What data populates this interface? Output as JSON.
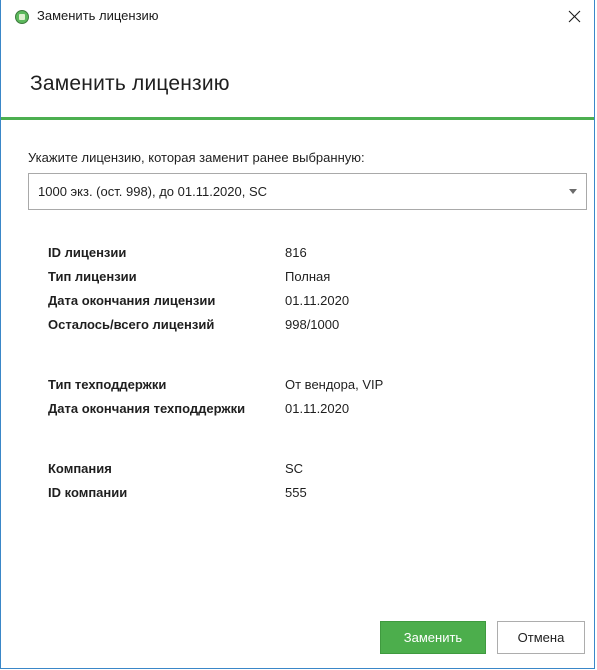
{
  "window": {
    "title": "Заменить лицензию",
    "close_glyph": "✕"
  },
  "header": {
    "title": "Заменить лицензию"
  },
  "form": {
    "prompt": "Укажите лицензию, которая заменит ранее выбранную:",
    "selected_license": "1000 экз. (ост. 998), до 01.11.2020, SC"
  },
  "license": {
    "id_label": "ID лицензии",
    "id_value": "816",
    "type_label": "Тип лицензии",
    "type_value": "Полная",
    "expiry_label": "Дата окончания лицензии",
    "expiry_value": "01.11.2020",
    "remaining_label": "Осталось/всего лицензий",
    "remaining_value": "998/1000"
  },
  "support": {
    "type_label": "Тип техподдержки",
    "type_value": "От вендора, VIP",
    "expiry_label": "Дата окончания техподдержки",
    "expiry_value": "01.11.2020"
  },
  "company": {
    "name_label": "Компания",
    "name_value": "SC",
    "id_label": "ID компании",
    "id_value": "555"
  },
  "buttons": {
    "replace": "Заменить",
    "cancel": "Отмена"
  },
  "colors": {
    "accent_green": "#4caf50",
    "window_border": "#3a87c8"
  }
}
